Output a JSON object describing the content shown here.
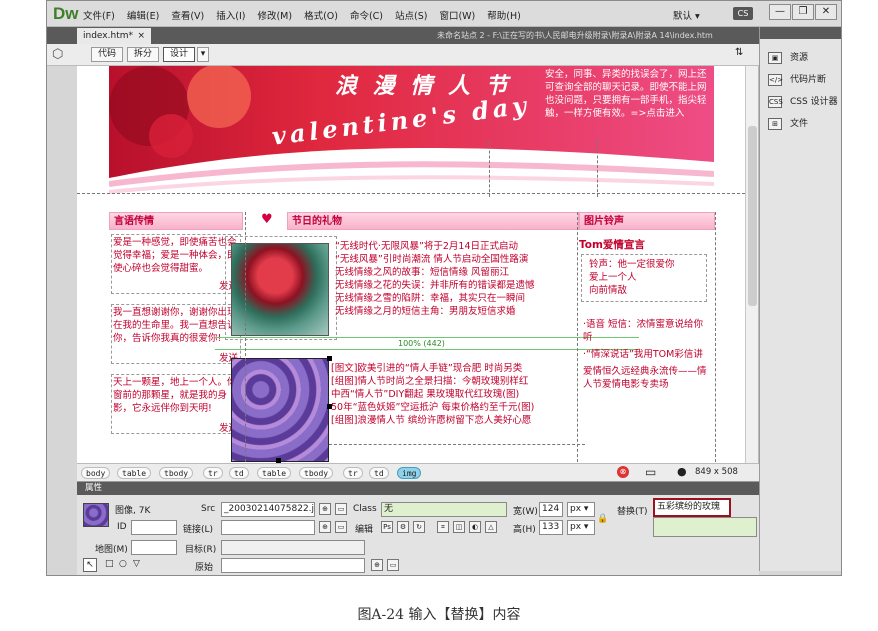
{
  "app": {
    "logo": "Dw",
    "menu": [
      "文件(F)",
      "编辑(E)",
      "查看(V)",
      "插入(I)",
      "修改(M)",
      "格式(O)",
      "命令(C)",
      "站点(S)",
      "窗口(W)",
      "帮助(H)"
    ],
    "workspace": "默认",
    "workspace_btn": "CS",
    "win_controls": [
      "—",
      "❐",
      "✕"
    ]
  },
  "document": {
    "tab_label": "index.htm*",
    "tab_close": "×",
    "path": "未命名站点 2 - F:\\正在写的书\\人民邮电升级附录\\附录A\\附录A 14\\index.htm",
    "views": [
      "代码",
      "拆分",
      "设计"
    ]
  },
  "right_panel": {
    "items": [
      "资源",
      "代码片断",
      "CSS 设计器",
      "文件"
    ]
  },
  "page": {
    "banner_text": "安全，同事、异类的找误会了，网上还可查询全部的聊天记录。即使不能上网也没问题，只要拥有一部手机，指尖轻触，一样方便有效。=>点击进入",
    "banner_title": "浪 漫 情 人 节",
    "banner_subtitle": "valentine's day",
    "sections": {
      "left": "言语传情",
      "middle": "节日的礼物",
      "right": "图片铃声"
    },
    "left_entries": [
      "爱是一种感觉，即使痛苦也会觉得幸福；爱是一种体会，即使心碎也会觉得甜蜜。",
      "我一直想谢谢你，谢谢你出现在我的生命里。我一直想告诉你，告诉你我真的很爱你!",
      "天上一颗星，地上一个人。你窗前的那颗星，就是我的身影，它永远伴你到天明!"
    ],
    "send_label": "发送",
    "news_1": [
      "“无线时代·无限风暴”将于2月14日正式启动",
      "“无线风暴”引时尚潮流 情人节启动全国性路演",
      "无线情缘之风的故事：短信情缘 风留丽江",
      "无线情缘之花的失误：并非所有的错误都是遗憾",
      "无线情缘之雪的陷阱：幸福，其实只在一瞬间",
      "无线情缘之月的短信主角：男朋友短信求婚"
    ],
    "progress_label": "100% (442)",
    "news_2": [
      "[图文]欧美引进的“情人手链”现合肥 时尚另类",
      "[组图]情人节时尚之全景扫描：今朝玫瑰别样红",
      "中西“情人节”DIY翻起 果玫瑰取代红玫瑰(图)",
      "50年“蓝色妖姬”空运抵沪 每束价格约至千元(图)",
      "[组图]浪漫情人节 缤纷许愿树留下恋人美好心愿"
    ],
    "right_title": "Tom爱情宣言",
    "right_box": [
      "铃声：他一定很爱你",
      "爱上一个人",
      "向前情敌"
    ],
    "right_list": [
      "·语音 短信：浓情蜜意说给你听",
      "·“情深说话”我用TOM彩信讲",
      "爱情恒久远经典永流传——情人节爱情电影专卖场"
    ]
  },
  "tag_selector": {
    "tags": [
      "body",
      "table",
      "tbody",
      "tr",
      "td",
      "table",
      "tbody",
      "tr",
      "td",
      "img"
    ],
    "size": "849 x 508"
  },
  "properties": {
    "title": "属性",
    "image_label": "图像, 7K",
    "id_label": "ID",
    "src_label": "Src",
    "src_value": "_20030214075822.jpg",
    "link_label": "链接(L)",
    "class_label": "Class",
    "class_value": "无",
    "edit_label": "编辑",
    "width_label": "宽(W)",
    "width_value": "124",
    "height_label": "高(H)",
    "height_value": "133",
    "unit": "px",
    "alt_label": "替换(T)",
    "alt_value": "五彩缤纷的玫瑰",
    "map_label": "地图(M)",
    "target_label": "目标(R)",
    "original_label": "原始"
  },
  "caption": "图A-24 输入【替换】内容",
  "colors": {
    "banner_pink": "#e8386a",
    "section_text": "#c2002c",
    "selected_tag": "#8fd3ea",
    "highlight": "#9a1220"
  }
}
